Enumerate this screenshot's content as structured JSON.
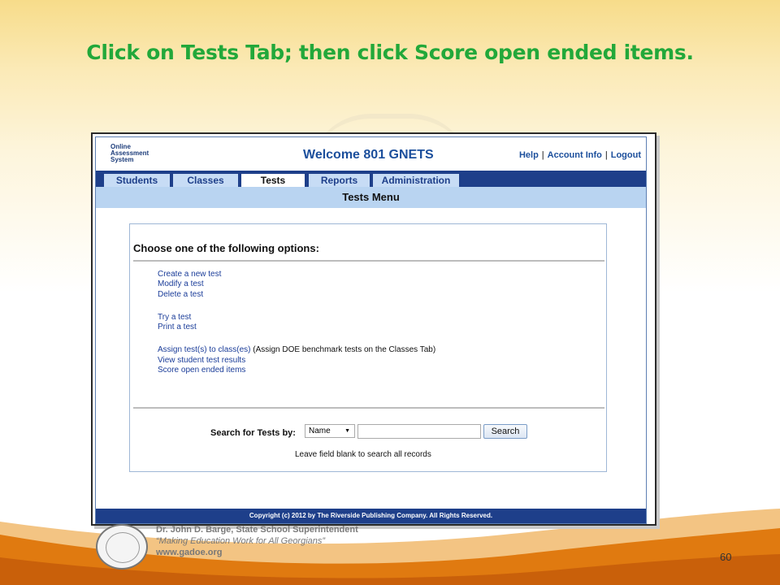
{
  "slide": {
    "title": "Click on Tests Tab; then click Score open ended items.",
    "page_number": "60"
  },
  "app": {
    "logo_lines": [
      "Online",
      "Assessment",
      "System"
    ],
    "welcome": "Welcome 801 GNETS",
    "top_links": [
      "Help",
      "Account Info",
      "Logout"
    ],
    "tabs": [
      {
        "label": "Students",
        "active": false
      },
      {
        "label": "Classes",
        "active": false
      },
      {
        "label": "Tests",
        "active": true
      },
      {
        "label": "Reports",
        "active": false
      },
      {
        "label": "Administration",
        "active": false
      }
    ],
    "section_title": "Tests Menu",
    "panel_heading": "Choose one of the following options:",
    "options": {
      "group1": [
        "Create a new test",
        "Modify a test",
        "Delete a test"
      ],
      "group2": [
        "Try a test",
        "Print a test"
      ],
      "assign_link": "Assign test(s) to class(es)",
      "assign_note": " (Assign DOE benchmark tests on the Classes Tab)",
      "group3": [
        "View student test results",
        "Score open ended items"
      ]
    },
    "search": {
      "label": "Search for Tests by:",
      "select_value": "Name",
      "input_value": "",
      "button_label": "Search",
      "hint": "Leave field blank to search all records"
    },
    "footer": "Copyright (c) 2012 by The Riverside Publishing Company. All Rights Reserved."
  },
  "credit": {
    "name": "Dr. John D. Barge, State School Superintendent",
    "motto": "“Making Education Work for All Georgians”",
    "url": "www.gadoe.org"
  },
  "colors": {
    "title_green": "#22a83a",
    "nav_blue": "#1e3f8a",
    "link_blue": "#1b3d99",
    "swoosh_orange": "#e07a10"
  }
}
